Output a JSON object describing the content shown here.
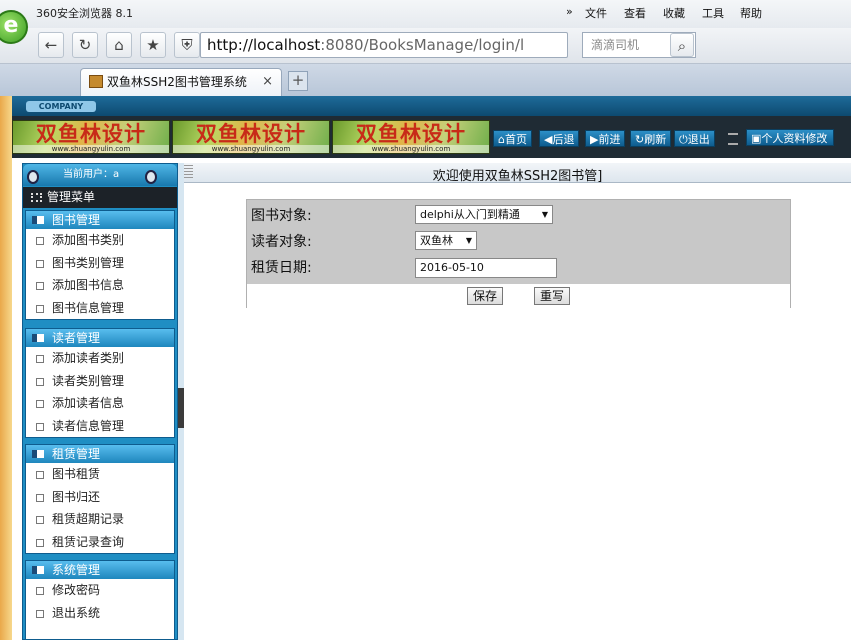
{
  "browser": {
    "title": "360安全浏览器 8.1",
    "menu": [
      "»",
      "文件",
      "查看",
      "收藏",
      "工具",
      "帮助"
    ],
    "url_host": "http://localhost",
    "url_rest": ":8080/BooksManage/login/l",
    "search_placeholder": "滴滴司机",
    "tab_title": "双鱼林SSH2图书管理系统",
    "tab_close": "×",
    "new_tab": "+"
  },
  "header": {
    "company": "COMPANY",
    "logo_text": "双鱼林设计",
    "logo_url": "www.shuangyulin.com",
    "nav": [
      "首页",
      "后退",
      "前进",
      "刷新",
      "退出"
    ],
    "profile": "个人资料修改"
  },
  "sidebar": {
    "current_user": "当前用户：a",
    "menu_title": "管理菜单",
    "sections": [
      {
        "title": "图书管理",
        "items": [
          "添加图书类别",
          "图书类别管理",
          "添加图书信息",
          "图书信息管理"
        ]
      },
      {
        "title": "读者管理",
        "items": [
          "添加读者类别",
          "读者类别管理",
          "添加读者信息",
          "读者信息管理"
        ]
      },
      {
        "title": "租赁管理",
        "items": [
          "图书租赁",
          "图书归还",
          "租赁超期记录",
          "租赁记录查询"
        ]
      },
      {
        "title": "系统管理",
        "items": [
          "修改密码",
          "退出系统"
        ]
      }
    ]
  },
  "main": {
    "welcome": "欢迎使用双鱼林SSH2图书管]",
    "form": {
      "book_label": "图书对象:",
      "book_value": "delphi从入门到精通",
      "reader_label": "读者对象:",
      "reader_value": "双鱼林",
      "date_label": "租赁日期:",
      "date_value": "2016-05-10",
      "save": "保存",
      "reset": "重写"
    }
  },
  "colors": {
    "accent": "#1f8ec3",
    "header_bg": "#1f2b34",
    "form_bg": "#c8c8c8"
  }
}
